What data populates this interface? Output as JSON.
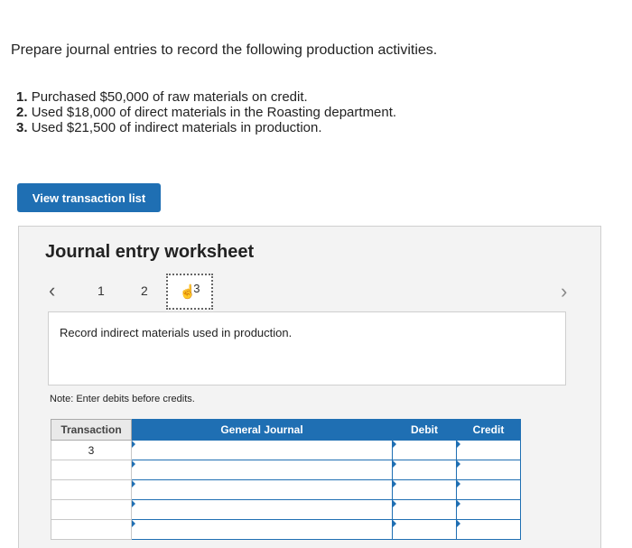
{
  "intro": "Prepare journal entries to record the following production activities.",
  "steps": [
    {
      "num": "1.",
      "text": "Purchased $50,000 of raw materials on credit."
    },
    {
      "num": "2.",
      "text": "Used $18,000 of direct materials in the Roasting department."
    },
    {
      "num": "3.",
      "text": "Used $21,500 of indirect materials in production."
    }
  ],
  "view_button": "View transaction list",
  "worksheet": {
    "title": "Journal entry worksheet",
    "pages": [
      "1",
      "2",
      "3"
    ],
    "current_page": "3",
    "description": "Record indirect materials used in production.",
    "note": "Note: Enter debits before credits.",
    "table": {
      "headers": [
        "Transaction",
        "General Journal",
        "Debit",
        "Credit"
      ],
      "first_transaction": "3"
    }
  },
  "colors": {
    "accent": "#1f6fb3"
  },
  "icons": {
    "prev": "chevron-left-icon",
    "next": "chevron-right-icon",
    "hand": "hand-pointer-icon"
  }
}
